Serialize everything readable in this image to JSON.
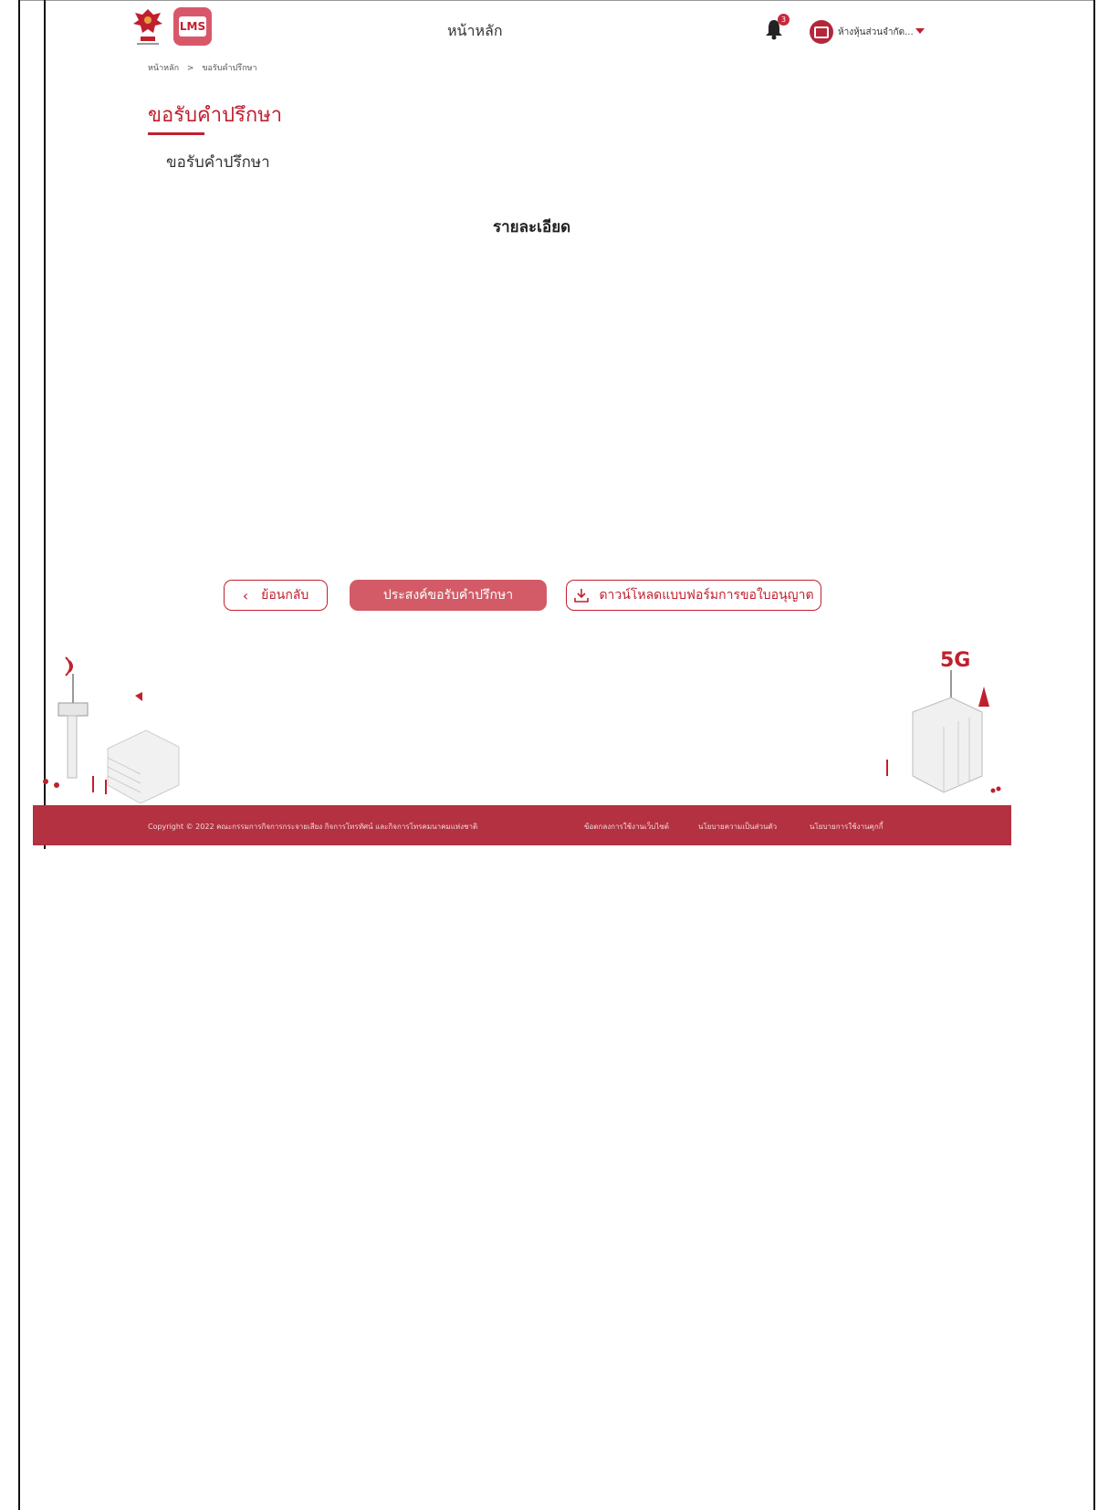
{
  "header": {
    "nav_home": "หน้าหลัก",
    "notification_count": "3",
    "user_name": "ห้างหุ้นส่วนจำกัด...",
    "lms_logo_text": "LMS"
  },
  "breadcrumb": {
    "home": "หน้าหลัก",
    "separator": ">",
    "current": "ขอรับคำปรึกษา"
  },
  "page": {
    "title": "ขอรับคำปรึกษา",
    "section_title": "ขอรับคำปรึกษา",
    "detail_heading": "รายละเอียด"
  },
  "actions": {
    "back_label": "ย้อนกลับ",
    "request_label": "ประสงค์ขอรับคำปรึกษา",
    "download_label": "ดาวน์โหลดแบบฟอร์มการขอใบอนุญาต"
  },
  "footer": {
    "copyright": "Copyright © 2022 คณะกรรมการกิจการกระจายเสียง กิจการโทรทัศน์ และกิจการโทรคมนาคมแห่งชาติ",
    "links": [
      "ข้อตกลงการใช้งานเว็บไซต์",
      "นโยบายความเป็นส่วนตัว",
      "นโยบายการใช้งานคุกกี้"
    ]
  },
  "illustration": {
    "badge_5g": "5G"
  },
  "colors": {
    "brand": "#c0202e",
    "button_fill": "#d25b67",
    "footer_bg": "#b33140"
  }
}
